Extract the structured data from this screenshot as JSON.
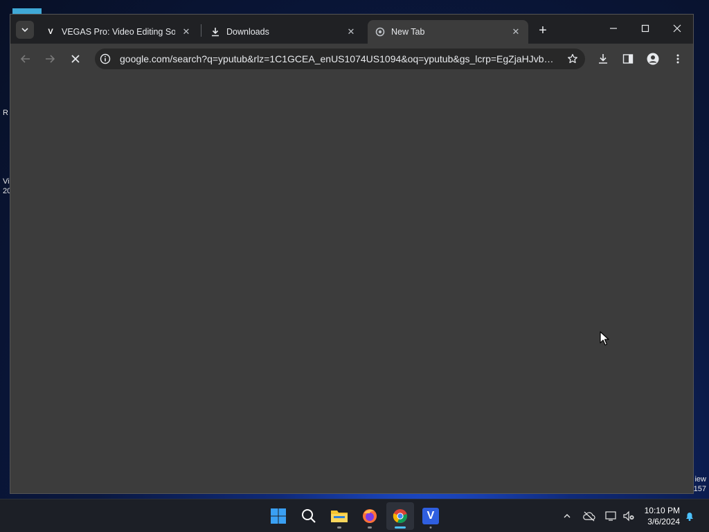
{
  "desktop": {
    "left_fragments": [
      "R",
      "Vi",
      "20"
    ],
    "right_fragments": [
      "iew",
      "157"
    ]
  },
  "browser": {
    "tabs": [
      {
        "favicon": "V",
        "title": "VEGAS Pro: Video Editing Softw",
        "active": false
      },
      {
        "favicon": "download-icon",
        "title": "Downloads",
        "active": false
      },
      {
        "favicon": "chrome-loading-icon",
        "title": "New Tab",
        "active": true
      }
    ],
    "address": {
      "url": "google.com/search?q=yputub&rlz=1C1GCEA_enUS1074US1094&oq=yputub&gs_lcrp=EgZjaHJvbW..."
    }
  },
  "taskbar": {
    "apps": [
      {
        "name": "start",
        "icon": "windows-start-icon"
      },
      {
        "name": "search",
        "icon": "search-icon"
      },
      {
        "name": "file-explorer",
        "icon": "folder-icon"
      },
      {
        "name": "firefox",
        "icon": "firefox-icon"
      },
      {
        "name": "chrome",
        "icon": "chrome-icon",
        "active": true
      },
      {
        "name": "vegas",
        "icon": "vegas-icon",
        "label": "V"
      }
    ],
    "clock": {
      "time": "10:10 PM",
      "date": "3/6/2024"
    }
  },
  "colors": {
    "titlebar": "#202124",
    "toolbar": "#3c3c3c",
    "omnibox": "#282828",
    "taskbar": "#1c1f26",
    "accent": "#4cc2ff"
  }
}
